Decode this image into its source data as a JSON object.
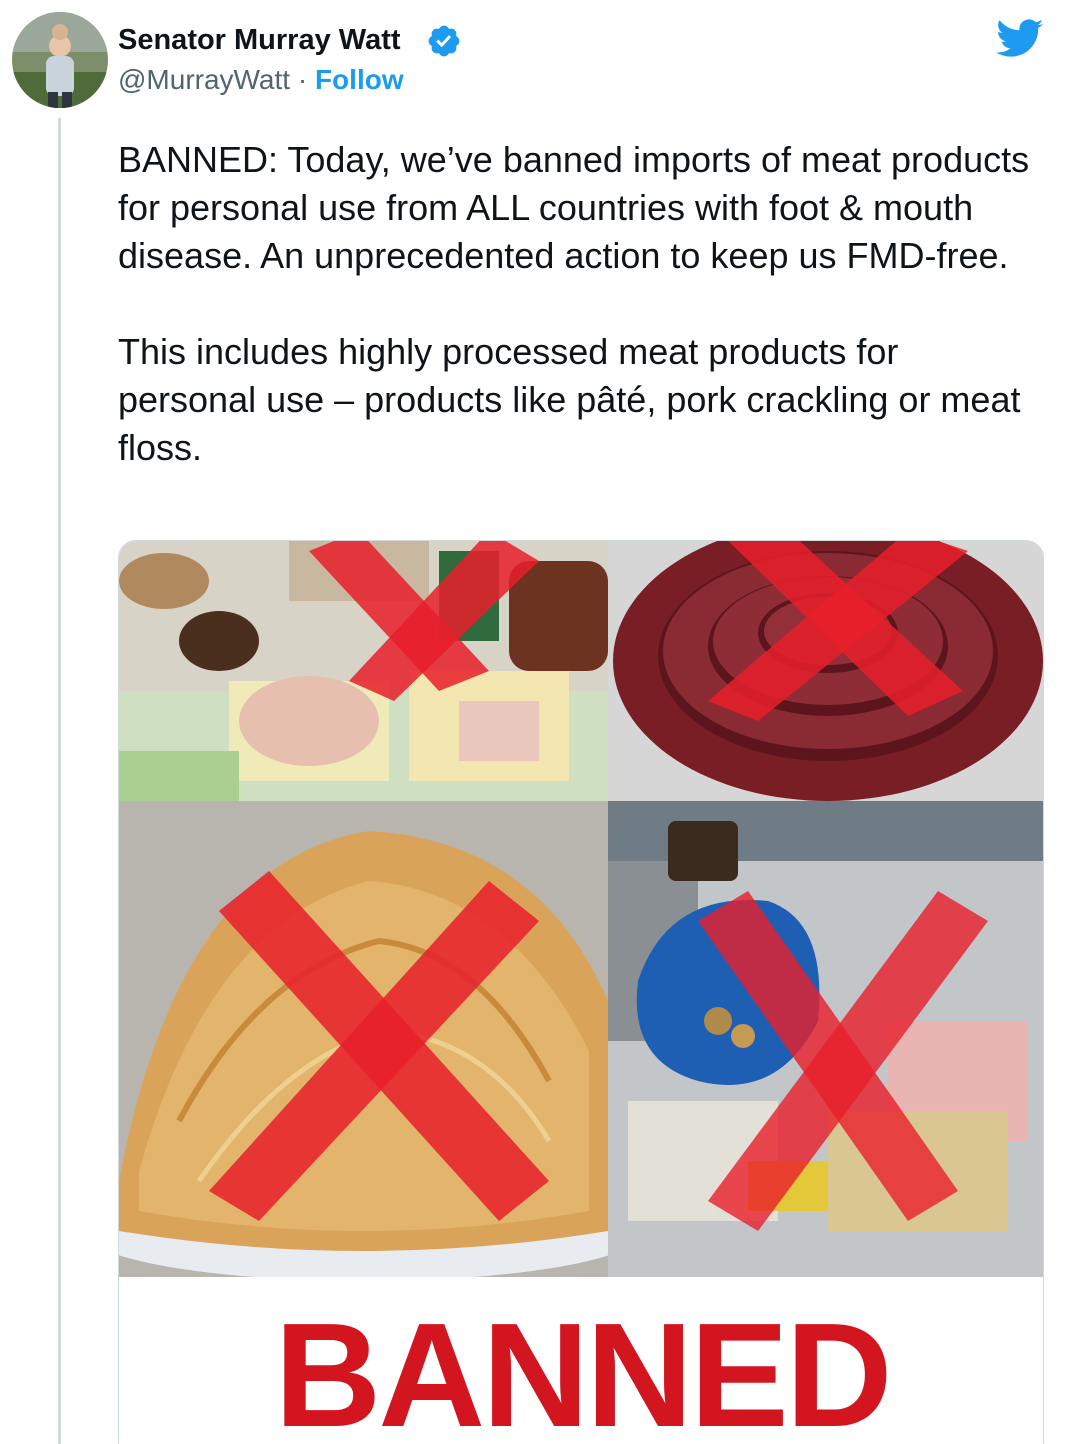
{
  "author": {
    "name": "Senator Murray Watt",
    "handle": "@MurrayWatt",
    "separator": "·",
    "follow_label": "Follow"
  },
  "icons": {
    "verified": "verified-badge-icon",
    "brand": "twitter-bird-icon"
  },
  "tweet": {
    "paragraph_1": "BANNED: Today, we’ve banned imports of meat products for personal use from ALL countries with foot & mouth disease. An unprecedented action to keep us FMD-free.",
    "paragraph_2": "This includes highly processed meat products for personal use – products like pâté, pork crackling or meat floss."
  },
  "media": {
    "banner_text": "BANNED"
  },
  "colors": {
    "accent": "#1d9bf0",
    "banned_red": "#d2151f",
    "text": "#0f1419",
    "muted": "#536471"
  }
}
